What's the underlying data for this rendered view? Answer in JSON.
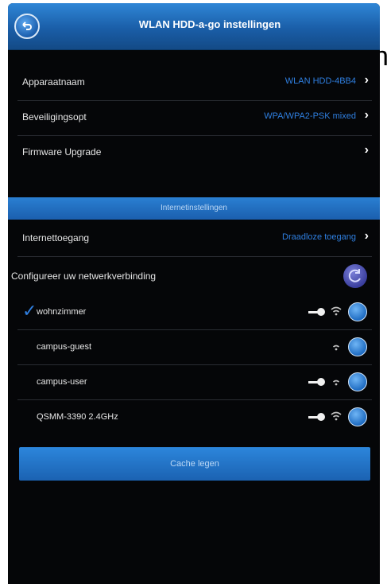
{
  "window": {
    "title": "WLAN HDD-a-go instellingen"
  },
  "settings": [
    {
      "label": "Apparaatnaam",
      "value": "WLAN HDD-4BB4"
    },
    {
      "label": "Beveiligingsopt",
      "value": "WPA/WPA2-PSK mixed"
    },
    {
      "label": "Firmware Upgrade",
      "value": ""
    }
  ],
  "section": {
    "label": "Internetinstellingen"
  },
  "internet": {
    "label": "Internettoegang",
    "value": "Draadloze toegang"
  },
  "configure": {
    "label": "Configureer uw netwerkverbinding"
  },
  "networks": [
    {
      "name": "wohnzimmer",
      "connected": true,
      "secured": true
    },
    {
      "name": "campus-guest",
      "connected": false,
      "secured": false
    },
    {
      "name": "campus-user",
      "connected": false,
      "secured": true
    },
    {
      "name": "QSMM-3390 2.4GHz",
      "connected": false,
      "secured": true
    }
  ],
  "button": {
    "label": "Cache legen"
  },
  "background_text": "n",
  "colors": {
    "accent": "#2f7fe0",
    "bar": "#1b5fae",
    "background": "#050608"
  },
  "icons": {
    "back": "back-arrow-icon",
    "chevron": "chevron-right-icon",
    "refresh": "refresh-icon",
    "key": "key-icon",
    "wifi": "wifi-icon",
    "info": "info-icon",
    "check": "checkmark-icon"
  }
}
